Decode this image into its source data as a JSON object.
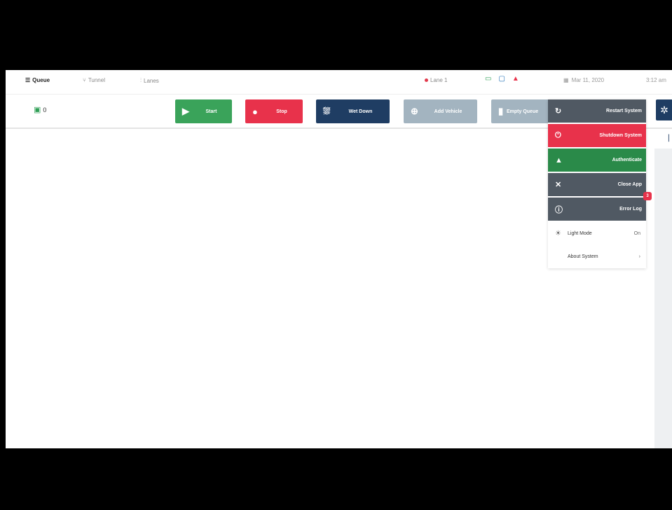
{
  "nav": {
    "tabs": [
      {
        "label": "Queue",
        "icon": "list-icon"
      },
      {
        "label": "Tunnel",
        "icon": "funnel-icon"
      },
      {
        "label": "Lanes",
        "icon": "lanes-icon"
      }
    ],
    "lane": "Lane 1",
    "date": "Mar 11, 2020",
    "time": "3:12 am"
  },
  "toolbar": {
    "vehicle_count": "0",
    "start_label": "Start",
    "stop_label": "Stop",
    "wet_label": "Wet Down",
    "add_label": "Add Vehicle",
    "empty_label": "Empty Queue"
  },
  "menu": {
    "restart": "Restart System",
    "shutdown": "Shutdown System",
    "authenticate": "Authenticate",
    "close": "Close App",
    "error": "Error Log",
    "error_badge": "3",
    "light_mode": "Light Mode",
    "light_mode_value": "On",
    "about": "About System"
  },
  "colors": {
    "start": "#3aa35a",
    "stop": "#e8324b",
    "wet": "#1f3d63",
    "disabled": "#a3b4c0",
    "menu_dark": "#505963",
    "authenticate": "#2a8a49"
  }
}
